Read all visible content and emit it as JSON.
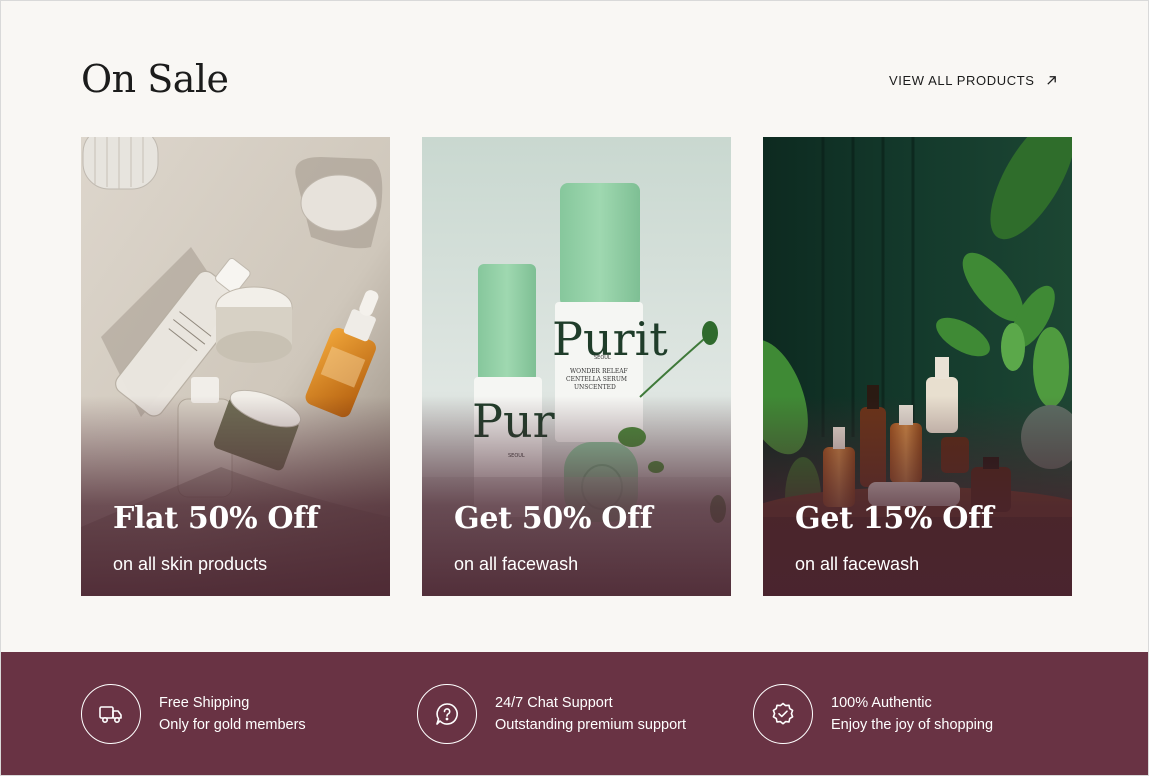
{
  "section": {
    "title": "On Sale",
    "view_all_label": "VIEW ALL PRODUCTS",
    "view_all_icon": "arrow-up-right-icon"
  },
  "cards": [
    {
      "headline": "Flat 50% Off",
      "subtitle": "on all skin products",
      "image": "skincare-bottles-flatlay"
    },
    {
      "headline": "Get 50% Off",
      "subtitle": "on all facewash",
      "image": "purito-serum-bottles",
      "product_label": "Purito",
      "product_sublabel": "SEOUL",
      "product_desc": "WONDER RELEAF CENTELLA SERUM UNSCENTED"
    },
    {
      "headline": "Get 15% Off",
      "subtitle": "on all facewash",
      "image": "bottles-with-plants"
    }
  ],
  "features": [
    {
      "icon": "truck-icon",
      "title": "Free Shipping",
      "subtitle": "Only for gold members"
    },
    {
      "icon": "chat-question-icon",
      "title": "24/7 Chat Support",
      "subtitle": "Outstanding premium support"
    },
    {
      "icon": "badge-check-icon",
      "title": "100% Authentic",
      "subtitle": "Enjoy the joy of shopping"
    }
  ],
  "colors": {
    "background": "#f9f7f4",
    "footer": "#693344",
    "text_dark": "#1c1c1c",
    "overlay": "#4a2430"
  }
}
